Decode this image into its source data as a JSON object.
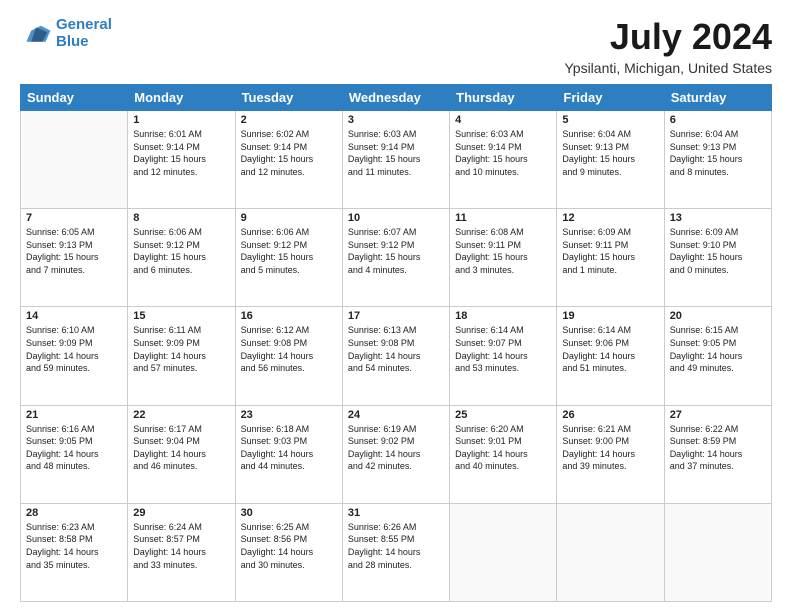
{
  "logo": {
    "line1": "General",
    "line2": "Blue"
  },
  "title": "July 2024",
  "subtitle": "Ypsilanti, Michigan, United States",
  "days_of_week": [
    "Sunday",
    "Monday",
    "Tuesday",
    "Wednesday",
    "Thursday",
    "Friday",
    "Saturday"
  ],
  "weeks": [
    [
      {
        "day": "",
        "info": ""
      },
      {
        "day": "1",
        "info": "Sunrise: 6:01 AM\nSunset: 9:14 PM\nDaylight: 15 hours\nand 12 minutes."
      },
      {
        "day": "2",
        "info": "Sunrise: 6:02 AM\nSunset: 9:14 PM\nDaylight: 15 hours\nand 12 minutes."
      },
      {
        "day": "3",
        "info": "Sunrise: 6:03 AM\nSunset: 9:14 PM\nDaylight: 15 hours\nand 11 minutes."
      },
      {
        "day": "4",
        "info": "Sunrise: 6:03 AM\nSunset: 9:14 PM\nDaylight: 15 hours\nand 10 minutes."
      },
      {
        "day": "5",
        "info": "Sunrise: 6:04 AM\nSunset: 9:13 PM\nDaylight: 15 hours\nand 9 minutes."
      },
      {
        "day": "6",
        "info": "Sunrise: 6:04 AM\nSunset: 9:13 PM\nDaylight: 15 hours\nand 8 minutes."
      }
    ],
    [
      {
        "day": "7",
        "info": "Sunrise: 6:05 AM\nSunset: 9:13 PM\nDaylight: 15 hours\nand 7 minutes."
      },
      {
        "day": "8",
        "info": "Sunrise: 6:06 AM\nSunset: 9:12 PM\nDaylight: 15 hours\nand 6 minutes."
      },
      {
        "day": "9",
        "info": "Sunrise: 6:06 AM\nSunset: 9:12 PM\nDaylight: 15 hours\nand 5 minutes."
      },
      {
        "day": "10",
        "info": "Sunrise: 6:07 AM\nSunset: 9:12 PM\nDaylight: 15 hours\nand 4 minutes."
      },
      {
        "day": "11",
        "info": "Sunrise: 6:08 AM\nSunset: 9:11 PM\nDaylight: 15 hours\nand 3 minutes."
      },
      {
        "day": "12",
        "info": "Sunrise: 6:09 AM\nSunset: 9:11 PM\nDaylight: 15 hours\nand 1 minute."
      },
      {
        "day": "13",
        "info": "Sunrise: 6:09 AM\nSunset: 9:10 PM\nDaylight: 15 hours\nand 0 minutes."
      }
    ],
    [
      {
        "day": "14",
        "info": "Sunrise: 6:10 AM\nSunset: 9:09 PM\nDaylight: 14 hours\nand 59 minutes."
      },
      {
        "day": "15",
        "info": "Sunrise: 6:11 AM\nSunset: 9:09 PM\nDaylight: 14 hours\nand 57 minutes."
      },
      {
        "day": "16",
        "info": "Sunrise: 6:12 AM\nSunset: 9:08 PM\nDaylight: 14 hours\nand 56 minutes."
      },
      {
        "day": "17",
        "info": "Sunrise: 6:13 AM\nSunset: 9:08 PM\nDaylight: 14 hours\nand 54 minutes."
      },
      {
        "day": "18",
        "info": "Sunrise: 6:14 AM\nSunset: 9:07 PM\nDaylight: 14 hours\nand 53 minutes."
      },
      {
        "day": "19",
        "info": "Sunrise: 6:14 AM\nSunset: 9:06 PM\nDaylight: 14 hours\nand 51 minutes."
      },
      {
        "day": "20",
        "info": "Sunrise: 6:15 AM\nSunset: 9:05 PM\nDaylight: 14 hours\nand 49 minutes."
      }
    ],
    [
      {
        "day": "21",
        "info": "Sunrise: 6:16 AM\nSunset: 9:05 PM\nDaylight: 14 hours\nand 48 minutes."
      },
      {
        "day": "22",
        "info": "Sunrise: 6:17 AM\nSunset: 9:04 PM\nDaylight: 14 hours\nand 46 minutes."
      },
      {
        "day": "23",
        "info": "Sunrise: 6:18 AM\nSunset: 9:03 PM\nDaylight: 14 hours\nand 44 minutes."
      },
      {
        "day": "24",
        "info": "Sunrise: 6:19 AM\nSunset: 9:02 PM\nDaylight: 14 hours\nand 42 minutes."
      },
      {
        "day": "25",
        "info": "Sunrise: 6:20 AM\nSunset: 9:01 PM\nDaylight: 14 hours\nand 40 minutes."
      },
      {
        "day": "26",
        "info": "Sunrise: 6:21 AM\nSunset: 9:00 PM\nDaylight: 14 hours\nand 39 minutes."
      },
      {
        "day": "27",
        "info": "Sunrise: 6:22 AM\nSunset: 8:59 PM\nDaylight: 14 hours\nand 37 minutes."
      }
    ],
    [
      {
        "day": "28",
        "info": "Sunrise: 6:23 AM\nSunset: 8:58 PM\nDaylight: 14 hours\nand 35 minutes."
      },
      {
        "day": "29",
        "info": "Sunrise: 6:24 AM\nSunset: 8:57 PM\nDaylight: 14 hours\nand 33 minutes."
      },
      {
        "day": "30",
        "info": "Sunrise: 6:25 AM\nSunset: 8:56 PM\nDaylight: 14 hours\nand 30 minutes."
      },
      {
        "day": "31",
        "info": "Sunrise: 6:26 AM\nSunset: 8:55 PM\nDaylight: 14 hours\nand 28 minutes."
      },
      {
        "day": "",
        "info": ""
      },
      {
        "day": "",
        "info": ""
      },
      {
        "day": "",
        "info": ""
      }
    ]
  ]
}
